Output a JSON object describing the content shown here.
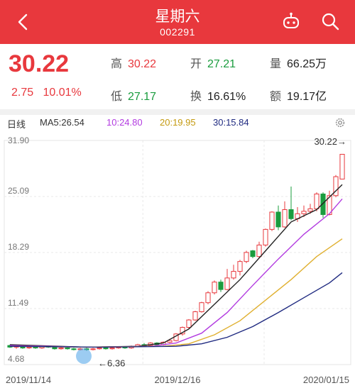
{
  "header": {
    "title": "星期六",
    "code": "002291"
  },
  "quote": {
    "price": "30.22",
    "change": "2.75",
    "change_pct": "10.01%",
    "high_label": "高",
    "high": "30.22",
    "open_label": "开",
    "open": "27.21",
    "volume_label": "量",
    "volume": "66.25万",
    "low_label": "低",
    "low": "27.17",
    "turnover_label": "换",
    "turnover": "16.61%",
    "amount_label": "额",
    "amount": "19.17亿"
  },
  "chart_bar": {
    "period": "日线",
    "ma5": "MA5:26.54",
    "ma10": "10:24.80",
    "ma20": "20:19.95",
    "ma30": "30:15.84"
  },
  "colors": {
    "up": "#e8383d",
    "down": "#1a9c3e",
    "ma5": "#222222",
    "ma10": "#b23be0",
    "ma20": "#e0b030",
    "ma30": "#1f2a80"
  },
  "chart_data": {
    "type": "candlestick",
    "y_ticks": [
      "31.90",
      "25.09",
      "18.29",
      "11.49",
      "4.68"
    ],
    "ylim": [
      4.68,
      31.9
    ],
    "x_labels": [
      "2019/11/14",
      "2019/12/16",
      "2020/01/15"
    ],
    "grid": true,
    "annotations": {
      "max_label": "30.22→",
      "min_label": "←6.36"
    },
    "candles": [
      [
        7.0,
        6.8,
        7.1,
        6.7
      ],
      [
        6.8,
        6.9,
        7.0,
        6.6
      ],
      [
        6.9,
        6.7,
        7.0,
        6.6
      ],
      [
        6.7,
        6.8,
        6.9,
        6.6
      ],
      [
        6.8,
        6.7,
        6.9,
        6.6
      ],
      [
        6.7,
        6.9,
        7.0,
        6.6
      ],
      [
        6.9,
        6.8,
        7.0,
        6.7
      ],
      [
        6.8,
        6.6,
        6.9,
        6.5
      ],
      [
        6.6,
        6.7,
        6.8,
        6.5
      ],
      [
        6.7,
        6.6,
        6.8,
        6.5
      ],
      [
        6.6,
        6.5,
        6.7,
        6.4
      ],
      [
        6.5,
        6.6,
        6.7,
        6.4
      ],
      [
        6.6,
        6.5,
        6.7,
        6.36
      ],
      [
        6.5,
        6.6,
        6.7,
        6.4
      ],
      [
        6.6,
        6.7,
        6.8,
        6.5
      ],
      [
        6.7,
        6.6,
        6.8,
        6.5
      ],
      [
        6.6,
        6.7,
        6.8,
        6.5
      ],
      [
        6.7,
        6.8,
        6.9,
        6.6
      ],
      [
        6.8,
        6.7,
        6.9,
        6.6
      ],
      [
        6.7,
        6.9,
        7.0,
        6.6
      ],
      [
        6.9,
        7.1,
        7.2,
        6.8
      ],
      [
        7.1,
        7.0,
        7.3,
        6.9
      ],
      [
        7.0,
        7.3,
        7.4,
        6.9
      ],
      [
        7.3,
        7.1,
        7.4,
        7.0
      ],
      [
        7.1,
        7.4,
        7.5,
        7.0
      ],
      [
        7.4,
        7.6,
        7.8,
        7.3
      ],
      [
        7.6,
        8.4,
        8.5,
        7.5
      ],
      [
        8.4,
        9.2,
        9.3,
        8.2
      ],
      [
        9.2,
        10.1,
        10.2,
        9.0
      ],
      [
        10.1,
        11.1,
        11.2,
        10.0
      ],
      [
        11.1,
        12.2,
        12.3,
        11.0
      ],
      [
        12.2,
        13.4,
        13.6,
        12.0
      ],
      [
        13.4,
        14.7,
        14.9,
        13.2
      ],
      [
        14.7,
        13.8,
        15.0,
        13.5
      ],
      [
        13.8,
        15.2,
        16.3,
        13.7
      ],
      [
        15.2,
        16.0,
        16.8,
        15.0
      ],
      [
        16.0,
        17.2,
        17.4,
        15.5
      ],
      [
        17.2,
        18.3,
        18.5,
        17.0
      ],
      [
        18.5,
        17.8,
        18.6,
        17.6
      ],
      [
        17.8,
        19.2,
        19.6,
        17.6
      ],
      [
        19.2,
        21.1,
        21.2,
        19.0
      ],
      [
        21.1,
        23.2,
        23.3,
        20.9
      ],
      [
        23.2,
        21.4,
        24.0,
        21.0
      ],
      [
        21.4,
        23.5,
        24.5,
        21.3
      ],
      [
        23.5,
        22.4,
        26.3,
        22.2
      ],
      [
        22.4,
        23.0,
        23.8,
        22.0
      ],
      [
        23.0,
        23.3,
        24.0,
        22.6
      ],
      [
        23.3,
        23.6,
        24.2,
        23.0
      ],
      [
        23.6,
        25.4,
        25.6,
        23.3
      ],
      [
        25.4,
        22.9,
        25.6,
        22.5
      ],
      [
        22.9,
        25.2,
        25.8,
        22.8
      ],
      [
        25.2,
        27.5,
        27.7,
        25.0
      ],
      [
        27.21,
        30.22,
        30.22,
        27.17
      ]
    ],
    "ma": {
      "ma5": [
        [
          0,
          7.1
        ],
        [
          12,
          6.8
        ],
        [
          20,
          6.9
        ],
        [
          24,
          7.3
        ],
        [
          28,
          9.0
        ],
        [
          32,
          12.0
        ],
        [
          36,
          15.0
        ],
        [
          40,
          18.5
        ],
        [
          44,
          22.0
        ],
        [
          48,
          23.5
        ],
        [
          52,
          26.54
        ]
      ],
      "ma10": [
        [
          0,
          7.0
        ],
        [
          12,
          6.8
        ],
        [
          22,
          6.9
        ],
        [
          26,
          7.3
        ],
        [
          30,
          8.5
        ],
        [
          34,
          11.0
        ],
        [
          38,
          14.3
        ],
        [
          42,
          17.5
        ],
        [
          46,
          20.5
        ],
        [
          50,
          23.0
        ],
        [
          52,
          24.8
        ]
      ],
      "ma20": [
        [
          0,
          6.9
        ],
        [
          12,
          6.8
        ],
        [
          24,
          6.9
        ],
        [
          28,
          7.2
        ],
        [
          32,
          8.3
        ],
        [
          36,
          10.0
        ],
        [
          40,
          12.5
        ],
        [
          44,
          15.0
        ],
        [
          48,
          17.8
        ],
        [
          52,
          19.95
        ]
      ],
      "ma30": [
        [
          0,
          6.9
        ],
        [
          14,
          6.8
        ],
        [
          26,
          6.9
        ],
        [
          30,
          7.2
        ],
        [
          34,
          8.0
        ],
        [
          38,
          9.3
        ],
        [
          42,
          11.0
        ],
        [
          46,
          12.8
        ],
        [
          50,
          14.6
        ],
        [
          52,
          15.84
        ]
      ]
    }
  }
}
